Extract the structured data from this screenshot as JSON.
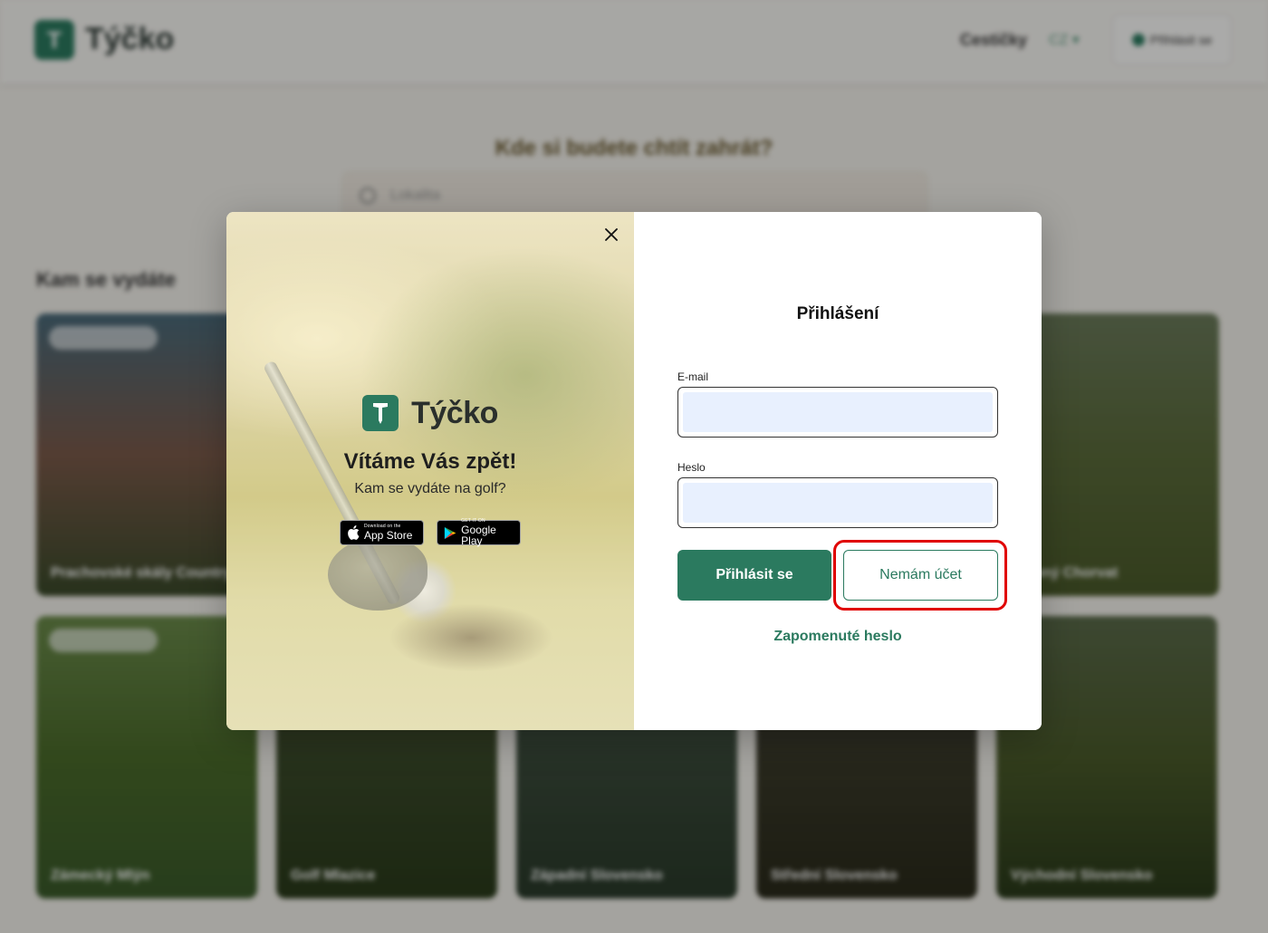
{
  "background": {
    "brand_name": "Týčko",
    "nav_link": "Cestičky",
    "lang": "CZ ▾",
    "login_button": "Přihlásit se",
    "hero_title": "Kde si budete chtít zahrát?",
    "search_placeholder": "Lokalita",
    "section_title": "Kam se vydáte",
    "cards": [
      {
        "label": "Prachovské skály Country",
        "colors": [
          "#4a6a7a",
          "#7a5a4a",
          "#3a4a2a"
        ]
      },
      {
        "label": "Slunný Chorvat",
        "colors": [
          "#6a7a5a",
          "#5a6a3a",
          "#4a5a2a"
        ]
      },
      {
        "label": "Zámecký Mlýn",
        "colors": [
          "#6a8a4a",
          "#4a6a2a",
          "#3a5a2a"
        ]
      },
      {
        "label": "Golf Mlazice",
        "colors": [
          "#5a5a3a",
          "#3a4a2a",
          "#2a3a1a"
        ]
      },
      {
        "label": "Západní Slovensko",
        "colors": [
          "#5a6a5a",
          "#3a4a3a",
          "#2a3a2a"
        ]
      },
      {
        "label": "Střední Slovensko",
        "colors": [
          "#4a4a4a",
          "#3a3a2a",
          "#2a2a1a"
        ]
      },
      {
        "label": "Východní Slovensko",
        "colors": [
          "#5a6a4a",
          "#4a5a2a",
          "#2a3a1a"
        ]
      }
    ]
  },
  "modal": {
    "close_icon": "close-icon",
    "brand_name": "Týčko",
    "welcome_title": "Vítáme Vás zpět!",
    "welcome_subtitle": "Kam se vydáte na golf?",
    "app_store": {
      "small": "Download on the",
      "big": "App Store"
    },
    "google_play": {
      "small": "GET IT ON",
      "big": "Google Play"
    },
    "login_title": "Přihlášení",
    "email_label": "E-mail",
    "email_value": "",
    "password_label": "Heslo",
    "password_value": "",
    "login_button": "Přihlásit se",
    "register_button": "Nemám účet",
    "forgot_password": "Zapomenuté heslo"
  },
  "colors": {
    "brand_green": "#2b7a5f",
    "highlight_red": "#e00000",
    "autofill_blue": "#e8f0fe"
  }
}
